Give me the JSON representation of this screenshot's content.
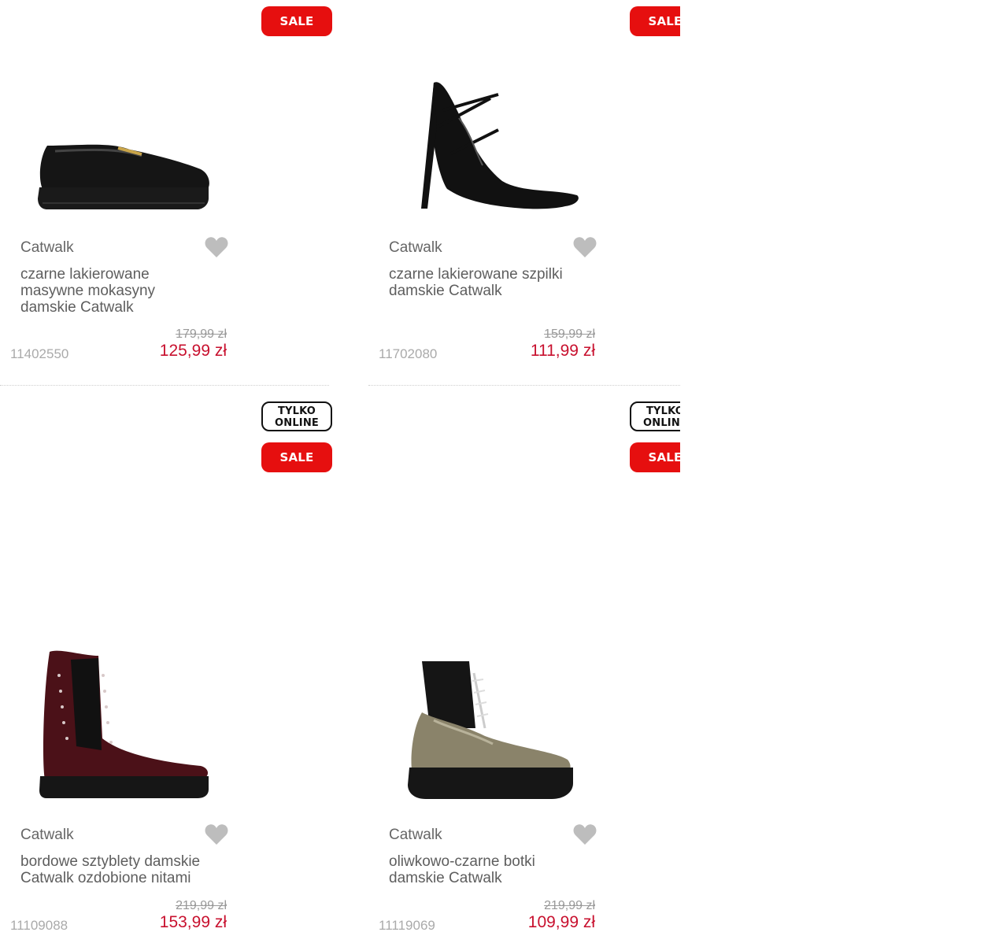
{
  "badges": {
    "sale": "SALE",
    "online_line1": "TYLKO",
    "online_line2": "ONLINE"
  },
  "products": [
    {
      "brand": "Catwalk",
      "name": "czarne lakierowane masywne mokasyny damskie Catwalk",
      "old_price": "179,99 zł",
      "price": "125,99 zł",
      "sku": "11402550",
      "image": "black-loafer"
    },
    {
      "brand": "Catwalk",
      "name": "czarne lakierowane szpilki damskie Catwalk",
      "old_price": "159,99 zł",
      "price": "111,99 zł",
      "sku": "11702080",
      "image": "black-stiletto"
    },
    {
      "brand": "Catwalk",
      "name": "bordowe sztyblety damskie Catwalk ozdobione nitami",
      "old_price": "219,99 zł",
      "price": "153,99 zł",
      "sku": "11109088",
      "image": "burgundy-chelsea-boot"
    },
    {
      "brand": "Catwalk",
      "name": "oliwkowo-czarne botki damskie Catwalk",
      "old_price": "219,99 zł",
      "price": "109,99 zł",
      "sku": "11119069",
      "image": "olive-black-boot"
    }
  ],
  "colors": {
    "sale": "#e60f0f",
    "price": "#c8102e",
    "heart": "#bdbdbd"
  }
}
